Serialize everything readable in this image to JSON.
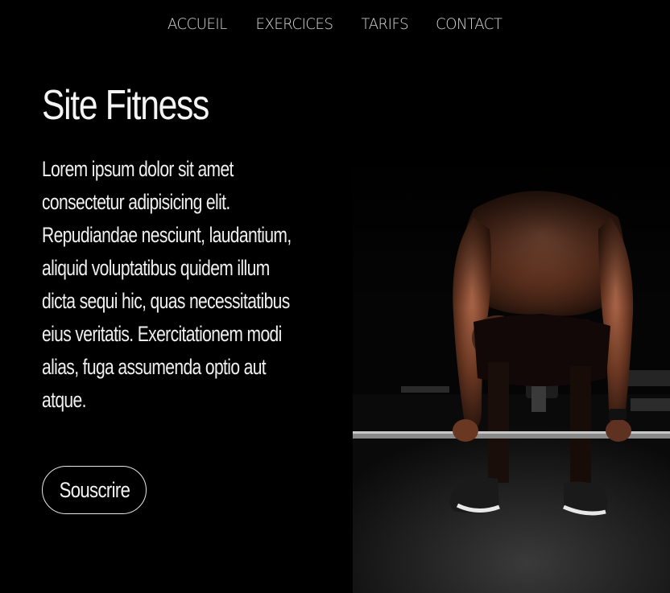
{
  "nav": {
    "items": [
      {
        "label": "ACCUEIL"
      },
      {
        "label": "EXERCICES"
      },
      {
        "label": "TARIFS"
      },
      {
        "label": "CONTACT"
      }
    ]
  },
  "hero": {
    "title": "Site Fitness",
    "description": "Lorem ipsum dolor sit amet consectetur adipisicing elit. Repudiandae nesciunt, laudantium, aliquid voluptatibus quidem illum dicta sequi hic, quas necessitatibus eius veritatis. Exercitationem modi alias, fuga assumenda optio aut atque.",
    "button_label": "Souscrire",
    "image_description": "Athlete gripping a barbell in a dark gym"
  },
  "colors": {
    "background": "#000000",
    "text": "#ffffff",
    "nav_text": "#d8d8d8"
  }
}
